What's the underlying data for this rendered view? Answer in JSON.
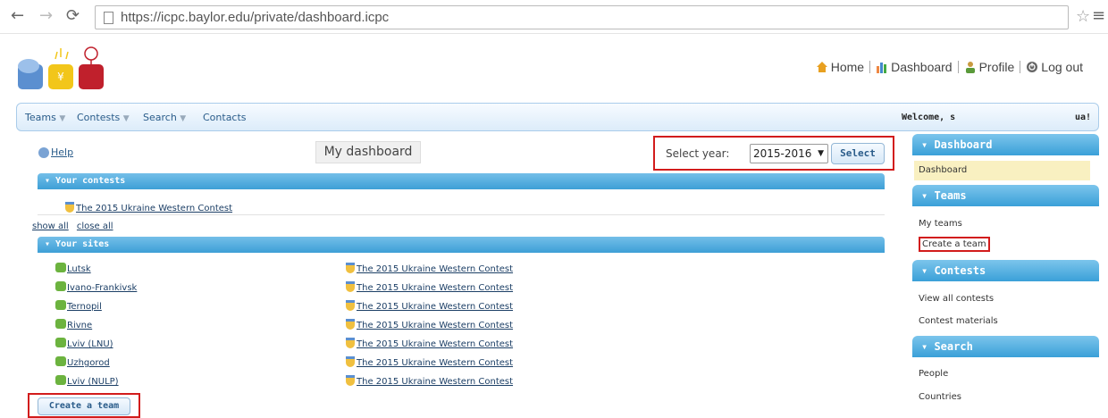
{
  "browser": {
    "url": "https://icpc.baylor.edu/private/dashboard.icpc"
  },
  "toplinks": {
    "home": "Home",
    "dashboard": "Dashboard",
    "profile": "Profile",
    "logout": "Log out"
  },
  "menu": {
    "teams": "Teams",
    "contests": "Contests",
    "search": "Search",
    "contacts": "Contacts",
    "welcome": "Welcome, s",
    "lang": "ua!"
  },
  "main": {
    "help": "Help",
    "title": "My dashboard",
    "year_label": "Select year:",
    "year_value": "2015-2016",
    "select_label": "Select",
    "your_contests_label": "Your contests",
    "contest_name": "The 2015 Ukraine Western Contest",
    "show_all": "show all",
    "close_all": "close all",
    "your_sites_label": "Your sites",
    "sites": [
      {
        "site": "Lutsk",
        "contest": "The 2015 Ukraine Western Contest"
      },
      {
        "site": "Ivano-Frankivsk",
        "contest": "The 2015 Ukraine Western Contest"
      },
      {
        "site": "Ternopil",
        "contest": "The 2015 Ukraine Western Contest"
      },
      {
        "site": "Rivne",
        "contest": "The 2015 Ukraine Western Contest"
      },
      {
        "site": "Lviv (LNU)",
        "contest": "The 2015 Ukraine Western Contest"
      },
      {
        "site": "Uzhgorod",
        "contest": "The 2015 Ukraine Western Contest"
      },
      {
        "site": "Lviv (NULP)",
        "contest": "The 2015 Ukraine Western Contest"
      }
    ],
    "create_team": "Create a team"
  },
  "sidebar": {
    "dashboard_head": "Dashboard",
    "dashboard_item": "Dashboard",
    "teams_head": "Teams",
    "my_teams": "My teams",
    "create_team": "Create a team",
    "contests_head": "Contests",
    "view_all_contests": "View all contests",
    "contest_materials": "Contest materials",
    "search_head": "Search",
    "people": "People",
    "countries": "Countries"
  },
  "colors": {
    "accent": "#3d9fd6",
    "highlight_box": "#d21c1c",
    "active_item": "#f9f0c1"
  }
}
